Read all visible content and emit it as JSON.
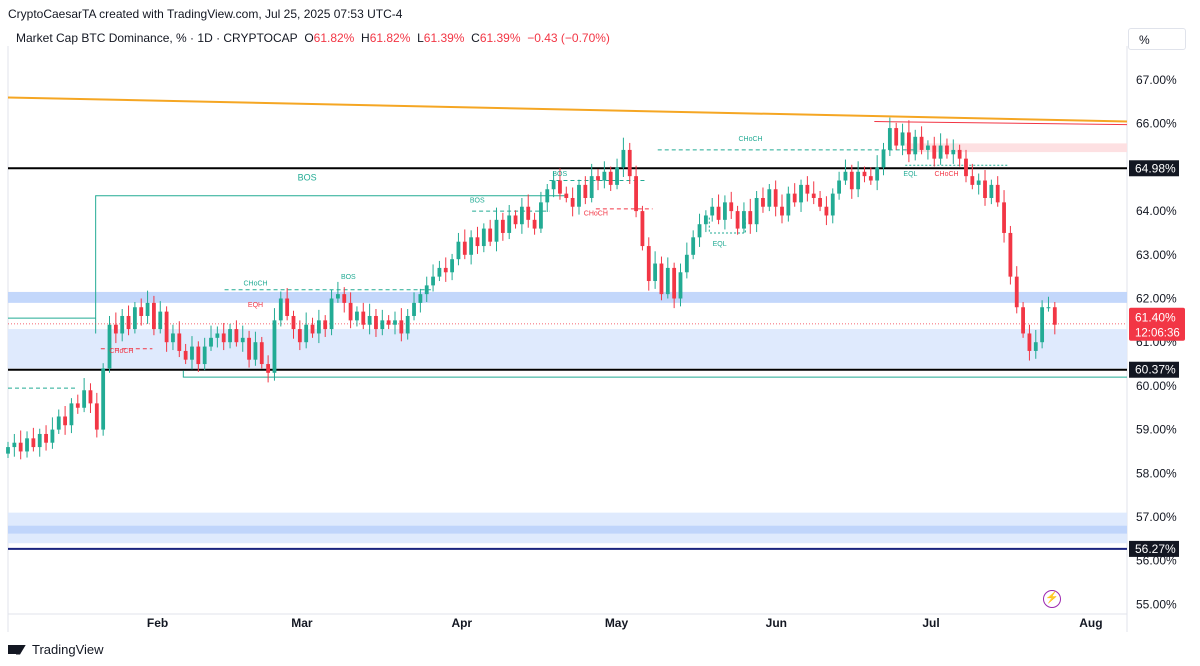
{
  "header": {
    "attribution": "CryptoCaesarTA created with TradingView.com, Jul 25, 2025 07:53 UTC-4",
    "symbol": "Market Cap BTC Dominance, % · 1D · CRYPTOCAP",
    "o_label": "O",
    "o_value": "61.82%",
    "h_label": "H",
    "h_value": "61.82%",
    "l_label": "L",
    "l_value": "61.39%",
    "c_label": "C",
    "c_value": "61.39%",
    "change": "−0.43 (−0.70%)",
    "unit_button": "%"
  },
  "footer": {
    "brand": "TradingView"
  },
  "colors": {
    "up": "#22ab94",
    "down": "#f23645",
    "zone": "#bcd3fb",
    "zone_light": "#dbe8fd",
    "trend": "#f5a623",
    "level": "#000000",
    "price_tag": "#f23645",
    "bos": "#22ab94",
    "choch": "#f23645"
  },
  "chart_data": {
    "type": "candlestick",
    "title": "Market Cap BTC Dominance, % · 1D · CRYPTOCAP",
    "ylim": [
      54.8,
      67.5
    ],
    "y_ticks": [
      "67.00%",
      "66.00%",
      "65.00%",
      "64.00%",
      "63.00%",
      "62.00%",
      "61.00%",
      "60.00%",
      "59.00%",
      "58.00%",
      "57.00%",
      "56.00%",
      "55.00%"
    ],
    "y_tick_values": [
      67,
      66,
      65,
      64,
      63,
      62,
      61,
      60,
      59,
      58,
      57,
      56,
      55
    ],
    "x_ticks": [
      "Feb",
      "Mar",
      "Apr",
      "May",
      "Jun",
      "Jul",
      "Aug"
    ],
    "x_tick_days": [
      31,
      59,
      90,
      120,
      151,
      181,
      212
    ],
    "x_start_day": 2,
    "x_end_day": 219,
    "closes": [
      58.6,
      58.7,
      58.5,
      58.8,
      58.6,
      58.9,
      58.7,
      59.0,
      59.3,
      59.1,
      59.6,
      59.5,
      59.9,
      59.6,
      59.0,
      60.4,
      61.4,
      61.2,
      61.6,
      61.3,
      61.8,
      61.6,
      61.9,
      61.3,
      61.7,
      61.0,
      61.2,
      60.8,
      60.6,
      60.9,
      60.5,
      60.9,
      61.1,
      61.2,
      61.0,
      61.3,
      61.0,
      61.1,
      60.6,
      61.0,
      60.5,
      60.3,
      61.5,
      62.0,
      61.6,
      61.3,
      61.0,
      61.4,
      61.2,
      61.5,
      61.3,
      62.0,
      62.1,
      61.9,
      61.5,
      61.7,
      61.4,
      61.6,
      61.3,
      61.5,
      61.4,
      61.5,
      61.2,
      61.6,
      61.9,
      62.1,
      62.3,
      62.5,
      62.7,
      62.6,
      62.9,
      63.3,
      63.0,
      63.4,
      63.2,
      63.6,
      63.3,
      63.8,
      63.5,
      63.9,
      63.7,
      64.1,
      63.8,
      63.6,
      64.2,
      64.5,
      64.7,
      64.4,
      64.3,
      64.1,
      64.6,
      64.3,
      64.8,
      64.7,
      64.9,
      64.6,
      65.0,
      65.4,
      64.8,
      64.0,
      63.2,
      62.4,
      62.8,
      62.1,
      62.7,
      62.0,
      62.6,
      63.0,
      63.4,
      63.7,
      63.9,
      64.1,
      63.8,
      64.2,
      64.0,
      63.6,
      64.0,
      63.7,
      64.3,
      64.1,
      64.5,
      64.1,
      63.9,
      64.4,
      64.2,
      64.6,
      64.4,
      64.3,
      64.1,
      63.9,
      64.4,
      64.7,
      64.9,
      64.5,
      64.9,
      64.8,
      64.7,
      65.0,
      65.4,
      65.9,
      65.5,
      65.8,
      65.3,
      65.7,
      65.4,
      65.5,
      65.2,
      65.5,
      65.3,
      65.4,
      65.2,
      64.8,
      64.6,
      64.7,
      64.3,
      64.6,
      64.2,
      63.5,
      62.5,
      61.8,
      61.2,
      60.8,
      61.0,
      61.8,
      61.8,
      61.4
    ],
    "levels": [
      {
        "label": "64.98%",
        "value": 64.98
      },
      {
        "label": "60.37%",
        "value": 60.37
      },
      {
        "label": "56.27%",
        "value": 56.27
      }
    ],
    "zones": [
      {
        "from": 61.9,
        "to": 62.15,
        "x_from_day": 2,
        "x_to_day": 219
      },
      {
        "from": 60.4,
        "to": 61.3,
        "x_from_day": 2,
        "x_to_day": 219
      },
      {
        "from": 56.4,
        "to": 57.1,
        "x_from_day": 2,
        "x_to_day": 219
      },
      {
        "from": 56.62,
        "to": 56.8,
        "x_from_day": 2,
        "x_to_day": 219
      }
    ],
    "trendline": {
      "from": [
        2,
        66.6
      ],
      "to": [
        219,
        66.05
      ]
    },
    "current_price": {
      "value_label": "61.40%",
      "countdown": "12:06:36",
      "value": 61.4
    },
    "annotations": [
      {
        "text": "BOS",
        "x_day": 60,
        "y": 64.7,
        "kind": "bos"
      },
      {
        "text": "CHoCH",
        "x_day": 24,
        "y": 60.75,
        "kind": "choch"
      },
      {
        "text": "EQH",
        "x_day": 50,
        "y": 61.8,
        "kind": "choch"
      },
      {
        "text": "CHoCH",
        "x_day": 50,
        "y": 62.3,
        "kind": "bos"
      },
      {
        "text": "BOS",
        "x_day": 68,
        "y": 62.45,
        "kind": "bos"
      },
      {
        "text": "BOS",
        "x_day": 93,
        "y": 64.2,
        "kind": "bos"
      },
      {
        "text": "BOS",
        "x_day": 109,
        "y": 64.8,
        "kind": "bos"
      },
      {
        "text": "CHoCH",
        "x_day": 116,
        "y": 63.9,
        "kind": "choch"
      },
      {
        "text": "CHoCH",
        "x_day": 146,
        "y": 65.6,
        "kind": "bos"
      },
      {
        "text": "EQL",
        "x_day": 140,
        "y": 63.2,
        "kind": "bos"
      },
      {
        "text": "EQL",
        "x_day": 177,
        "y": 64.8,
        "kind": "bos"
      },
      {
        "text": "CHoCH",
        "x_day": 184,
        "y": 64.8,
        "kind": "choch"
      }
    ]
  }
}
